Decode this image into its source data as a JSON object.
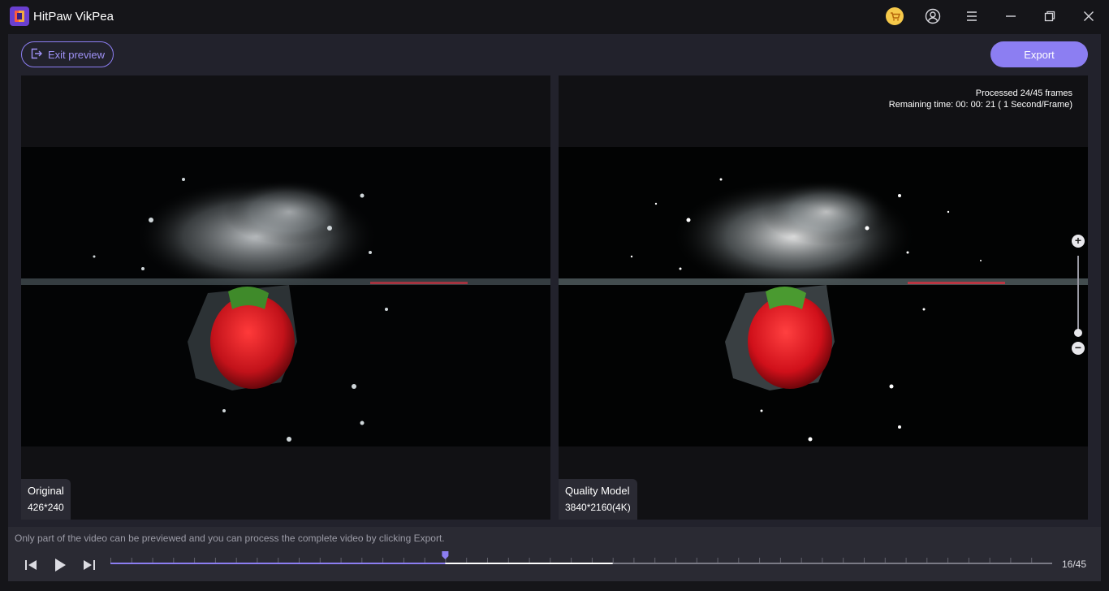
{
  "app": {
    "title": "HitPaw VikPea"
  },
  "titlebar_icons": [
    "cart-icon",
    "account-icon",
    "menu-icon",
    "minimize-icon",
    "restore-icon",
    "close-icon"
  ],
  "toolbar": {
    "exit_label": "Exit preview",
    "export_label": "Export"
  },
  "left_panel": {
    "label": "Original",
    "resolution": "426*240"
  },
  "right_panel": {
    "label": "Quality Model",
    "resolution": "3840*2160(4K)",
    "processed": "Processed 24/45 frames",
    "remaining": "Remaining time: 00: 00: 21 ( 1 Second/Frame)"
  },
  "zoom": {
    "plus": "+",
    "minus": "−",
    "level": 0
  },
  "footer": {
    "notice": "Only part of the video can be previewed and you can process the complete video by clicking Export.",
    "frame_counter": "16/45",
    "current_frame": 16,
    "processed_frames": 24,
    "total_frames": 45
  },
  "colors": {
    "accent": "#8c7ef2",
    "background": "#151519",
    "panel": "#22222c"
  }
}
